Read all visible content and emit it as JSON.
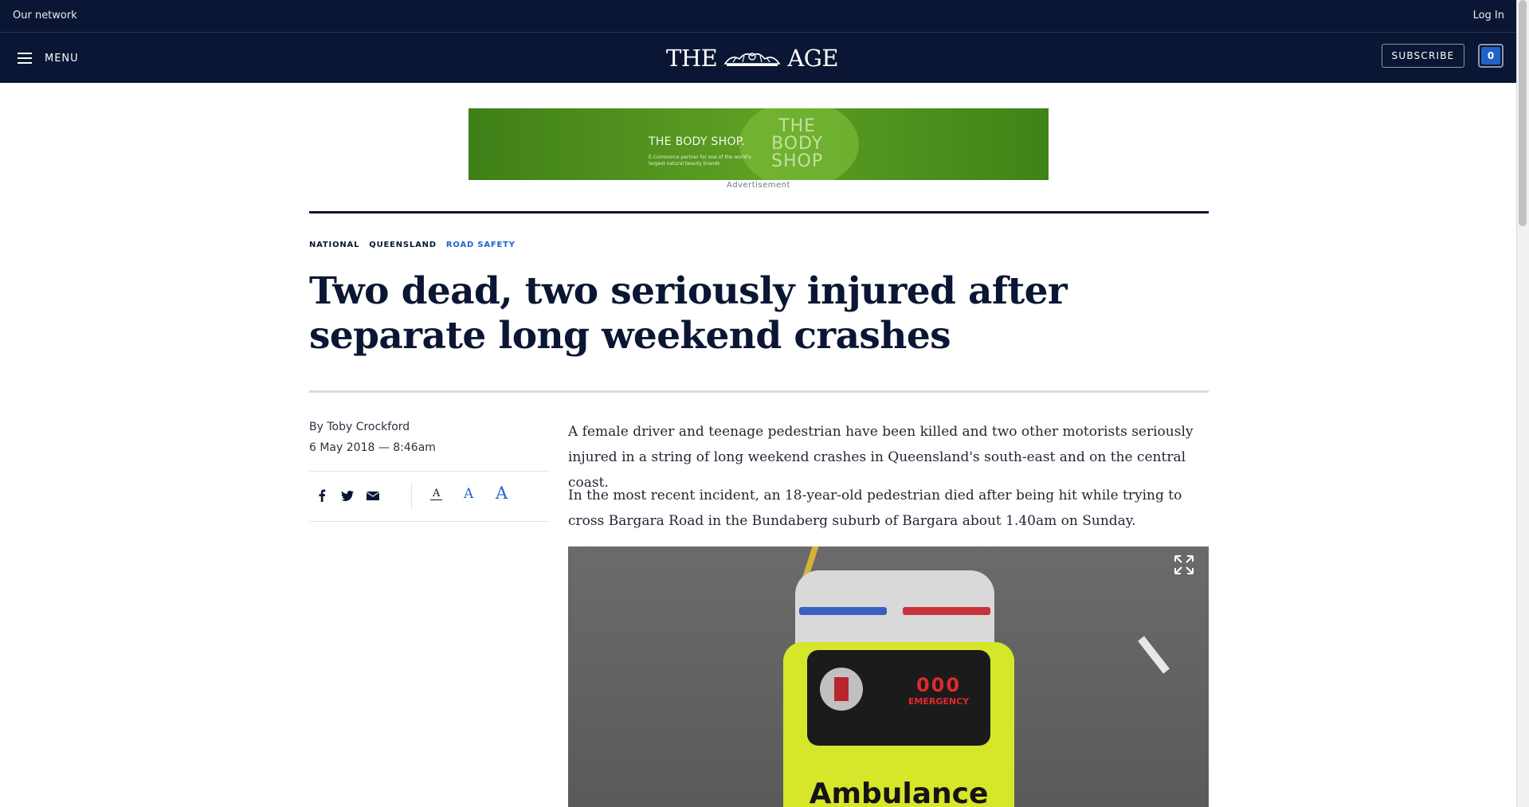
{
  "topbar": {
    "network": "Our network",
    "login": "Log In"
  },
  "nav": {
    "menu": "MENU",
    "logo_left": "THE",
    "logo_right": "AGE",
    "subscribe": "SUBSCRIBE",
    "counter": "0"
  },
  "ad": {
    "brand": "THE BODY SHOP.",
    "tagline": "E-Commerce partner for one of the world's largest natural beauty brands",
    "big_line1": "THE",
    "big_line2": "BODY",
    "big_line3": "SHOP",
    "label": "Advertisement"
  },
  "article": {
    "tags": [
      "NATIONAL",
      "QUEENSLAND",
      "ROAD SAFETY"
    ],
    "headline": "Two dead, two seriously injured after separate long weekend crashes",
    "byline": "By Toby Crockford",
    "date": "6 May 2018 — 8:46am",
    "paragraphs": [
      "A female driver and teenage pedestrian have been killed and two other motorists seriously injured in a string of long weekend crashes in Queensland's south-east and on the central coast.",
      "In the most recent incident, an 18-year-old pedestrian died after being hit while trying to cross Bargara Road in the Bundaberg suburb of Bargara about 1.40am on Sunday."
    ],
    "font_size_options": [
      "A",
      "A",
      "A"
    ],
    "photo": {
      "van_text": "Ambulance",
      "emergency_number": "000",
      "emergency_label": "EMERGENCY"
    }
  },
  "icons": [
    "menu-icon",
    "crest-icon",
    "facebook-icon",
    "twitter-icon",
    "email-icon",
    "expand-icon"
  ],
  "colors": {
    "header_bg": "#0a1633",
    "accent_blue": "#1f63c9"
  }
}
